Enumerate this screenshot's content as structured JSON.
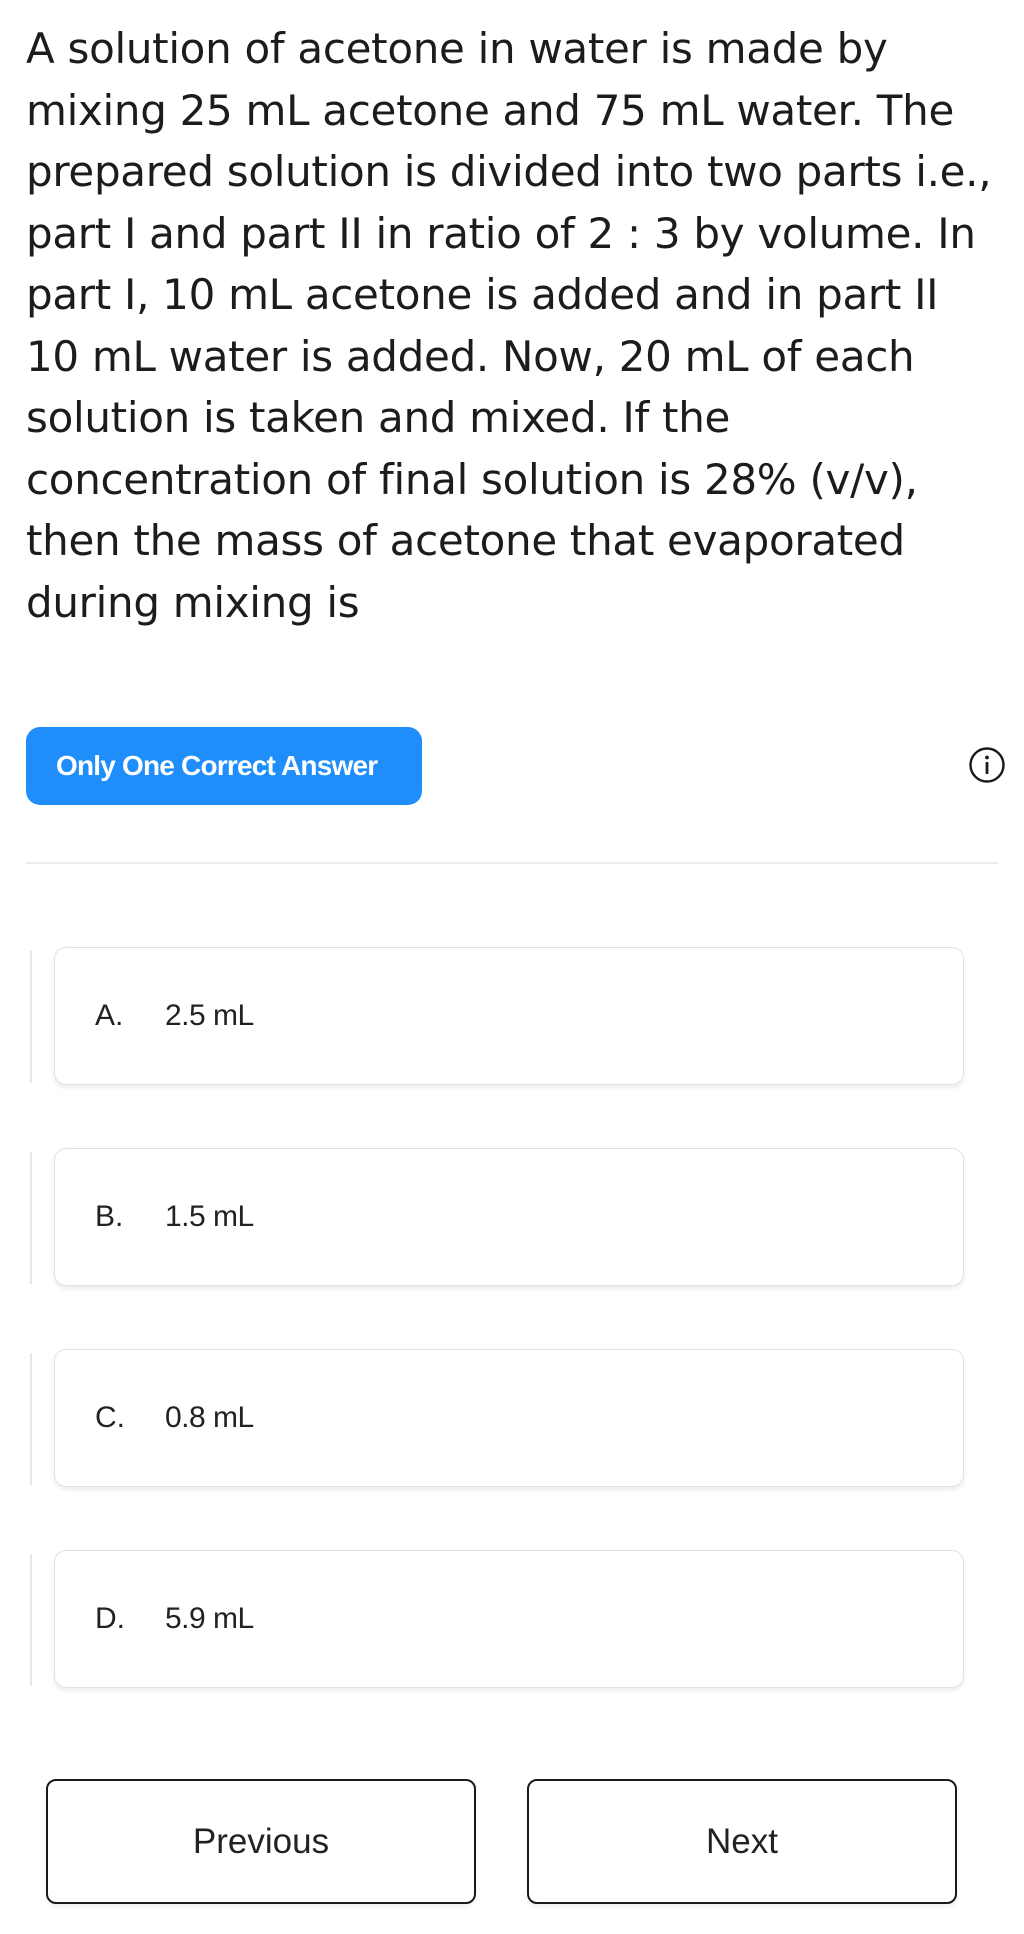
{
  "question": {
    "text": "A solution of acetone in water is made by mixing 25 mL acetone and 75 mL water. The prepared solution is divided into two parts i.e., part I and part II in ratio of 2 : 3 by volume. In part I, 10 mL acetone is added and in part II 10 mL water is added. Now, 20 mL of each solution is taken and mixed. If the concentration of final solution is 28% (v/v), then the mass of acetone that evaporated during mixing is"
  },
  "question_type": {
    "label": "Only One Correct Answer",
    "color": "#1f8efa",
    "icon": "info-icon"
  },
  "options": [
    {
      "letter": "A.",
      "value": "2.5 mL"
    },
    {
      "letter": "B.",
      "value": "1.5 mL"
    },
    {
      "letter": "C.",
      "value": "0.8 mL"
    },
    {
      "letter": "D.",
      "value": "5.9 mL"
    }
  ],
  "navigation": {
    "previous_label": "Previous",
    "next_label": "Next"
  }
}
